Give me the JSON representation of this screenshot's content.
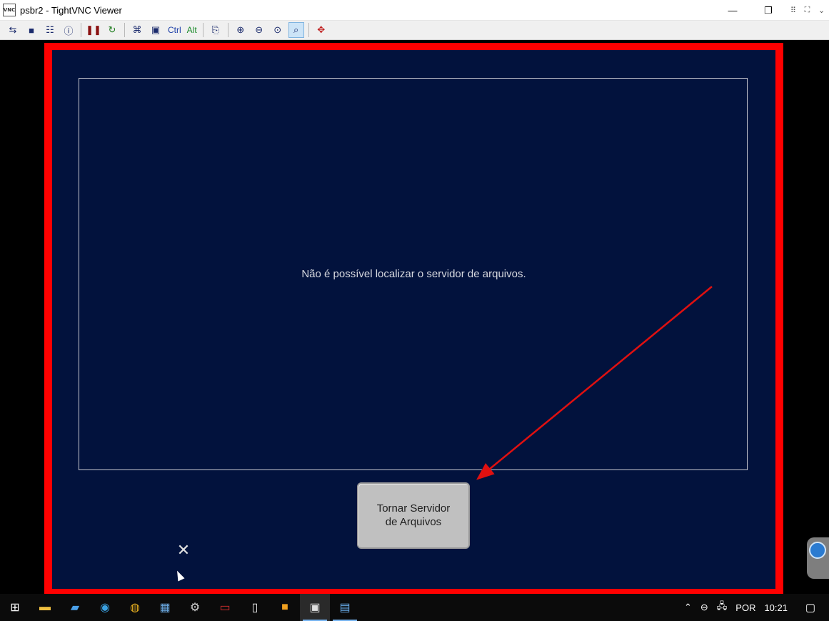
{
  "window": {
    "title": "psbr2 - TightVNC Viewer",
    "app_icon_text": "VNC"
  },
  "title_controls": {
    "minimize": "—",
    "restore": "❐",
    "close": "✕",
    "extra": [
      "⠿",
      "⛶",
      "⌄"
    ]
  },
  "toolbar": {
    "ctrl_label": "Ctrl",
    "alt_label": "Alt"
  },
  "remote": {
    "message": "Não é possível localizar o servidor de arquivos.",
    "button_label": "Tornar Servidor\nde Arquivos",
    "close_glyph": "✕",
    "frame_color": "#ff0000",
    "background_color": "#02123d",
    "annotation_arrow_color": "#e01010"
  },
  "taskbar": {
    "language": "POR",
    "time": "10:21"
  }
}
